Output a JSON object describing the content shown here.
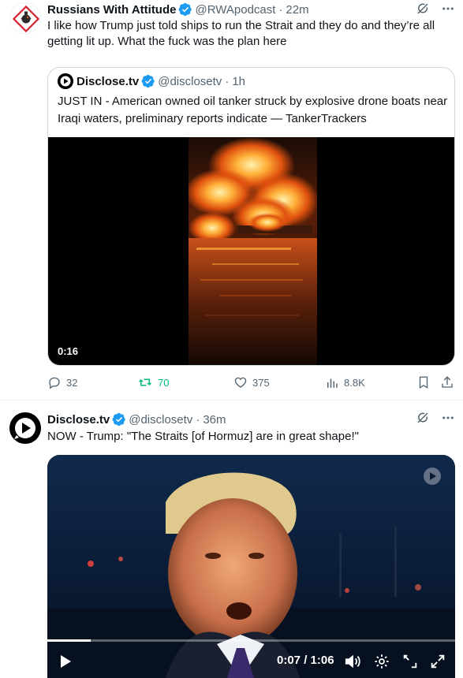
{
  "tweet1": {
    "name": "Russians With Attitude",
    "handle": "@RWApodcast",
    "separator": "·",
    "time": "22m",
    "text": "I like how Trump just told ships to run the Strait and they do and they’re all getting lit up. What the fuck was the plan here",
    "quote": {
      "name": "Disclose.tv",
      "handle": "@disclosetv",
      "separator": "·",
      "time": "1h",
      "text": "JUST IN - American owned oil tanker struck by explosive drone boats near Iraqi waters, preliminary reports indicate — TankerTrackers",
      "video_duration": "0:16"
    },
    "actions": {
      "replies": "32",
      "reposts": "70",
      "likes": "375",
      "views": "8.8K"
    }
  },
  "tweet2": {
    "name": "Disclose.tv",
    "handle": "@disclosetv",
    "separator": "·",
    "time": "36m",
    "text": "NOW - Trump: \"The Straits [of Hormuz] are in great shape!\"",
    "video": {
      "timer": "0:07 / 1:06",
      "progress": 0.106
    }
  },
  "colors": {
    "verified": "#1d9bf0",
    "repost_active": "#00ba7c",
    "muted_text": "#536471"
  }
}
